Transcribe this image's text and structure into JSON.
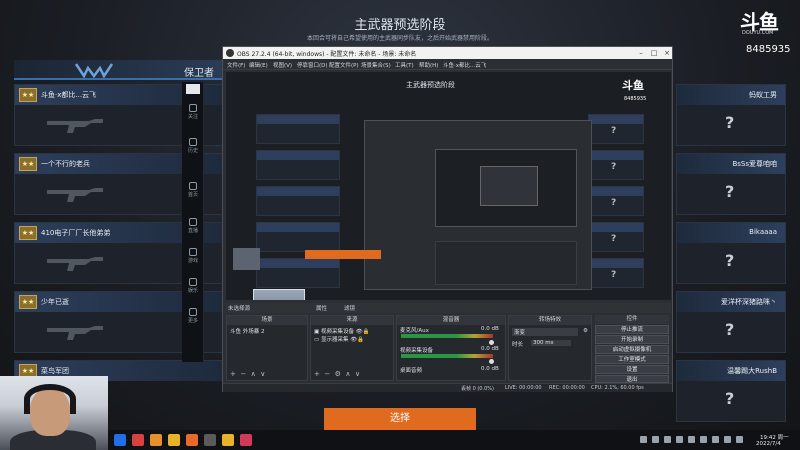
{
  "game": {
    "title": "主武器预选阶段",
    "subtitle": "本回合可将自己希望使用的主武器同步队友，之后开始武器禁用阶段。",
    "team_name": "保卫者",
    "select_button": "选择",
    "left_players": [
      {
        "name": "斗鱼·x都比...云飞",
        "rank": "★★"
      },
      {
        "name": "一个不行的老兵",
        "rank": "★★"
      },
      {
        "name": "410电子厂厂长他弟弟",
        "rank": "★★"
      },
      {
        "name": "少年已逝",
        "rank": "★★"
      },
      {
        "name": "菜鸟军团",
        "rank": "★★"
      }
    ],
    "right_players": [
      {
        "name": "蚂蚁工男"
      },
      {
        "name": "BsSs爱尊咱咱"
      },
      {
        "name": "Bikaaaa"
      },
      {
        "name": "爱洋杯深猪路咪丶"
      },
      {
        "name": "温馨踢大RushB"
      }
    ],
    "unknown_weapon": "?"
  },
  "douyu": {
    "logo_text": "斗鱼",
    "site": "DOUYU.COM",
    "room_id": "8485935"
  },
  "client_sidebar": {
    "items": [
      "关注",
      "历史",
      "首页",
      "直播",
      "游戏",
      "娱乐",
      "更多"
    ]
  },
  "obs": {
    "title": "OBS 27.2.4 (64-bit, windows) - 配置文件: 未命名 - 场景: 未命名",
    "menu": [
      "文件(F)",
      "编辑(E)",
      "视图(V)",
      "停靠窗口(D)",
      "配置文件(P)",
      "场景集合(S)",
      "工具(T)",
      "帮助(H)",
      "斗鱼·x都比...云飞"
    ],
    "preview": {
      "title": "主武器预选阶段",
      "logo_text": "斗鱼",
      "site": "DOUYU.COM",
      "room_id": "8485935"
    },
    "source_selected": "未选择源",
    "controls_bar": [
      "属性",
      "滤镜"
    ],
    "docks": {
      "scenes": {
        "header": "场景",
        "items": [
          "斗鱼 外场暴 2"
        ]
      },
      "sources": {
        "header": "来源",
        "items": [
          "视频采集设备",
          "显示器采集"
        ]
      },
      "mixer": {
        "header": "混音器",
        "channels": [
          {
            "name": "麦克风/Aux",
            "db": "0.0 dB"
          },
          {
            "name": "视频采集设备",
            "db": "0.0 dB"
          },
          {
            "name": "桌面音频",
            "db": "0.0 dB"
          }
        ]
      },
      "transitions": {
        "header": "转场特效",
        "type": "渐变",
        "duration_label": "时长",
        "duration_value": "300 ms"
      },
      "controls": {
        "header": "控件",
        "buttons": [
          "停止推流",
          "开始录制",
          "启动虚拟摄像机",
          "工作室模式",
          "设置",
          "退出"
        ]
      }
    },
    "status": {
      "dropped": "丢帧 0 (0.0%)",
      "live": "LIVE: 00:00:00",
      "rec": "REC: 00:00:00",
      "cpu": "CPU: 2.1%, 60.00 fps",
      "bitrate": "kb/s: 0"
    }
  },
  "taskbar": {
    "time": "19:42 周一",
    "date": "2022/7/4",
    "icon_colors": [
      "#1f6feb",
      "#d94040",
      "#e8902a",
      "#e8b12a",
      "#e86a2a",
      "#5a5a5a",
      "#e8b12a",
      "#d23a5a"
    ]
  },
  "colors": {
    "accent_orange": "#e06a1e",
    "team_blue": "#3a6ea8",
    "rank_gold": "#c9a34e"
  }
}
